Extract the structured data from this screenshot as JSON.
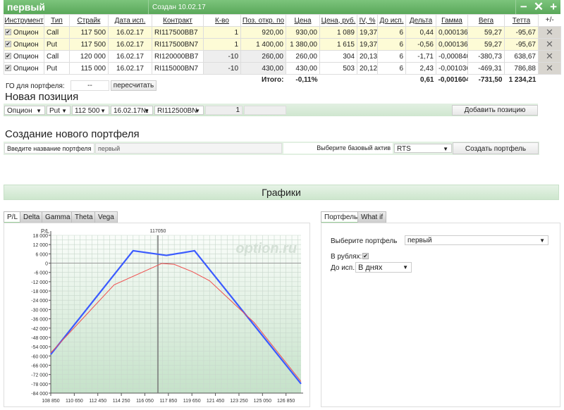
{
  "header": {
    "title": "первый",
    "created": "Создан 10.02.17",
    "minimize": "−",
    "close": "✕",
    "add": "+"
  },
  "table": {
    "columns": [
      "Инструмент",
      "Тип",
      "Страйк",
      "Дата исп.",
      "Контракт",
      "К-во",
      "Поз. откр. по",
      "Цена",
      "Цена, руб.",
      "IV, %",
      "До исп.",
      "Дельта",
      "Гамма",
      "Вега",
      "Тетта",
      "+/-"
    ],
    "rows": [
      {
        "checked": true,
        "instrument": "Опцион",
        "type": "Call",
        "strike": "117 500",
        "date": "16.02.17",
        "contract": "RI117500BB7",
        "qty": "1",
        "open": "920,00",
        "price": "930,00",
        "price_rub": "1 089",
        "iv": "19,37",
        "days": "6",
        "delta": "0,44",
        "gamma": "0,000136",
        "vega": "59,27",
        "theta": "-95,67",
        "highlight": true
      },
      {
        "checked": true,
        "instrument": "Опцион",
        "type": "Put",
        "strike": "117 500",
        "date": "16.02.17",
        "contract": "RI117500BN7",
        "qty": "1",
        "open": "1 400,00",
        "price": "1 380,00",
        "price_rub": "1 615",
        "iv": "19,37",
        "days": "6",
        "delta": "-0,56",
        "gamma": "0,000136",
        "vega": "59,27",
        "theta": "-95,67",
        "highlight": true
      },
      {
        "checked": true,
        "instrument": "Опцион",
        "type": "Call",
        "strike": "120 000",
        "date": "16.02.17",
        "contract": "RI120000BB7",
        "qty": "-10",
        "open": "260,00",
        "price": "260,00",
        "price_rub": "304",
        "iv": "20,13",
        "days": "6",
        "delta": "-1,71",
        "gamma": "-0,000840",
        "vega": "-380,73",
        "theta": "638,67",
        "highlight": false
      },
      {
        "checked": true,
        "instrument": "Опцион",
        "type": "Put",
        "strike": "115 000",
        "date": "16.02.17",
        "contract": "RI115000BN7",
        "qty": "-10",
        "open": "430,00",
        "price": "430,00",
        "price_rub": "503",
        "iv": "20,12",
        "days": "6",
        "delta": "2,43",
        "gamma": "-0,001036",
        "vega": "-469,31",
        "theta": "786,88",
        "highlight": false
      }
    ],
    "totals": {
      "label": "Итого:",
      "pct": "-0,11%",
      "delta": "0,61",
      "gamma": "-0,001604",
      "vega": "-731,50",
      "theta": "1 234,21"
    }
  },
  "go": {
    "label": "ГО для портфеля:",
    "value": "--",
    "recalc": "пересчитать"
  },
  "new_position": {
    "title": "Новая позиция",
    "instrument": "Опцион",
    "type": "Put",
    "strike": "112 500",
    "date": "16.02.17№",
    "contract": "RI112500BN",
    "qty": "1",
    "add": "Добавить позицию"
  },
  "create": {
    "title": "Создание нового портфеля",
    "name_label": "Введите название портфеля",
    "name_value": "первый",
    "asset_label": "Выберите базовый актив",
    "asset": "RTS",
    "button": "Создать портфель"
  },
  "charts": {
    "title": "Графики",
    "tabs": [
      "P/L",
      "Delta",
      "Gamma",
      "Theta",
      "Vega"
    ],
    "active_tab": "P/L"
  },
  "side": {
    "tabs": [
      "Портфель",
      "What if"
    ],
    "portfolio_label": "Выберите портфель",
    "portfolio": "первый",
    "rub_label": "В рублях:",
    "rub_checked": true,
    "exp_label": "До исп.:",
    "exp": "В днях"
  },
  "chart_data": {
    "type": "line",
    "ylabel": "P/L",
    "marker_label": "117050",
    "marker_x": 117050,
    "watermark": "option.ru",
    "xlim": [
      108850,
      128000
    ],
    "ylim": [
      -84000,
      18000
    ],
    "xticks": [
      108850,
      110650,
      112450,
      114250,
      116050,
      117850,
      119650,
      121450,
      123250,
      125050,
      126850
    ],
    "xtick_labels": [
      "108 850",
      "110 650",
      "112 450",
      "114 250",
      "116 050",
      "117 850",
      "119 650",
      "121 450",
      "123 250",
      "125 050",
      "126 850"
    ],
    "yticks": [
      18000,
      12000,
      6000,
      0,
      -6000,
      -12000,
      -18000,
      -24000,
      -30000,
      -36000,
      -42000,
      -48000,
      -54000,
      -60000,
      -66000,
      -72000,
      -78000,
      -84000
    ],
    "ytick_labels": [
      "18 000",
      "12 000",
      "6 000",
      "0",
      "-6 000",
      "-12 000",
      "-18 000",
      "-24 000",
      "-30 000",
      "-36 000",
      "-42 000",
      "-48 000",
      "-54 000",
      "-60 000",
      "-66 000",
      "-72 000",
      "-78 000",
      "-84 000"
    ],
    "grid": true,
    "series": [
      {
        "color": "#3b5bff",
        "points": [
          [
            108850,
            -59000
          ],
          [
            115150,
            8000
          ],
          [
            117700,
            5000
          ],
          [
            119850,
            8000
          ],
          [
            128000,
            -78000
          ]
        ]
      },
      {
        "color": "#f05050",
        "points": [
          [
            108850,
            -58000
          ],
          [
            113700,
            -14000
          ],
          [
            117350,
            -200
          ],
          [
            118300,
            -800
          ],
          [
            119700,
            -5600
          ],
          [
            121000,
            -11400
          ],
          [
            124400,
            -38300
          ],
          [
            128000,
            -76500
          ]
        ]
      }
    ]
  }
}
